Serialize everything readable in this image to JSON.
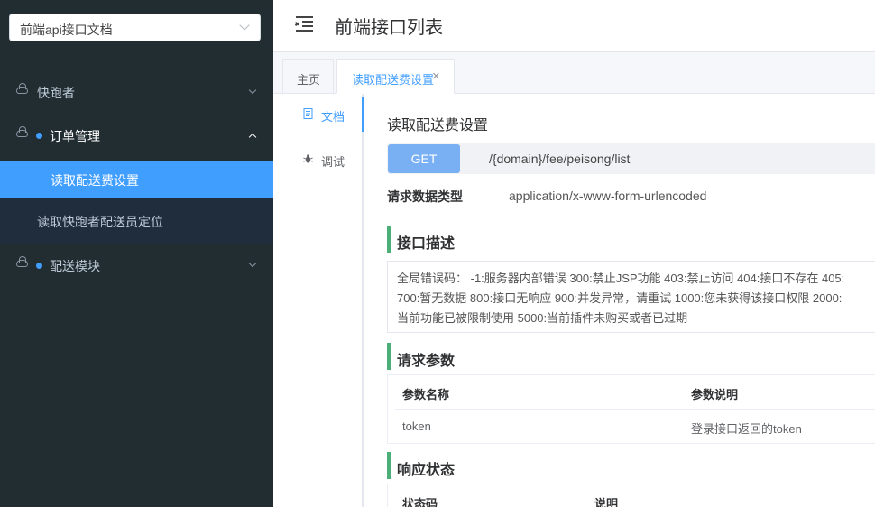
{
  "sidebar": {
    "select": {
      "value": "前端api接口文档"
    },
    "menu": [
      {
        "label": "快跑者"
      },
      {
        "label": "订单管理"
      },
      {
        "label": "配送模块"
      }
    ],
    "submenu": [
      {
        "label": "读取配送费设置"
      },
      {
        "label": "读取快跑者配送员定位"
      }
    ]
  },
  "header": {
    "title": "前端接口列表"
  },
  "tabs": [
    {
      "label": "主页"
    },
    {
      "label": "读取配送费设置",
      "close": "×"
    }
  ],
  "vtabs": [
    {
      "label": "文档"
    },
    {
      "label": "调试"
    }
  ],
  "doc": {
    "title": "读取配送费设置",
    "method": "GET",
    "url": "/{domain}/fee/peisong/list",
    "request_type_label": "请求数据类型",
    "request_type_value": "application/x-www-form-urlencoded",
    "sections": {
      "description": "接口描述",
      "params": "请求参数",
      "response": "响应状态"
    },
    "description_lines": [
      "全局错误码： -1:服务器内部错误 300:禁止JSP功能 403:禁止访问 404:接口不存在 405:",
      "700:暂无数据 800:接口无响应 900:并发异常，请重试 1000:您未获得该接口权限 2000:",
      "当前功能已被限制使用 5000:当前插件未购买或者已过期"
    ],
    "params_table": {
      "headers": [
        "参数名称",
        "参数说明"
      ],
      "rows": [
        [
          "token",
          "登录接口返回的token"
        ]
      ]
    },
    "response_table": {
      "headers": [
        "状态码",
        "说明"
      ]
    }
  },
  "colors": {
    "accent": "#409eff",
    "sidebar_bg": "#222d32",
    "section_accent": "#4caf78"
  }
}
